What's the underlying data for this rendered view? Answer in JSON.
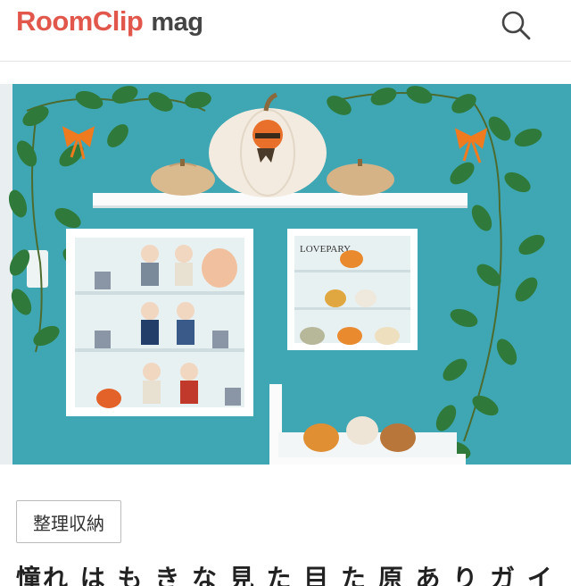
{
  "header": {
    "brand": "RoomClip",
    "mag": "mag",
    "search_icon": "search-icon"
  },
  "photo": {
    "sign_text": "LOVEPARY",
    "colors": {
      "wall": "#3fa6b4",
      "shelf": "#fbfbfb",
      "leaf": "#2f7a3a",
      "ribbon": "#f07a1e",
      "pumpkin_orange": "#e98a2f"
    }
  },
  "article": {
    "category": "整理収納",
    "title": "憧れ は も き な 見 た 目 た 原 あ り ガ イ ン ス"
  }
}
